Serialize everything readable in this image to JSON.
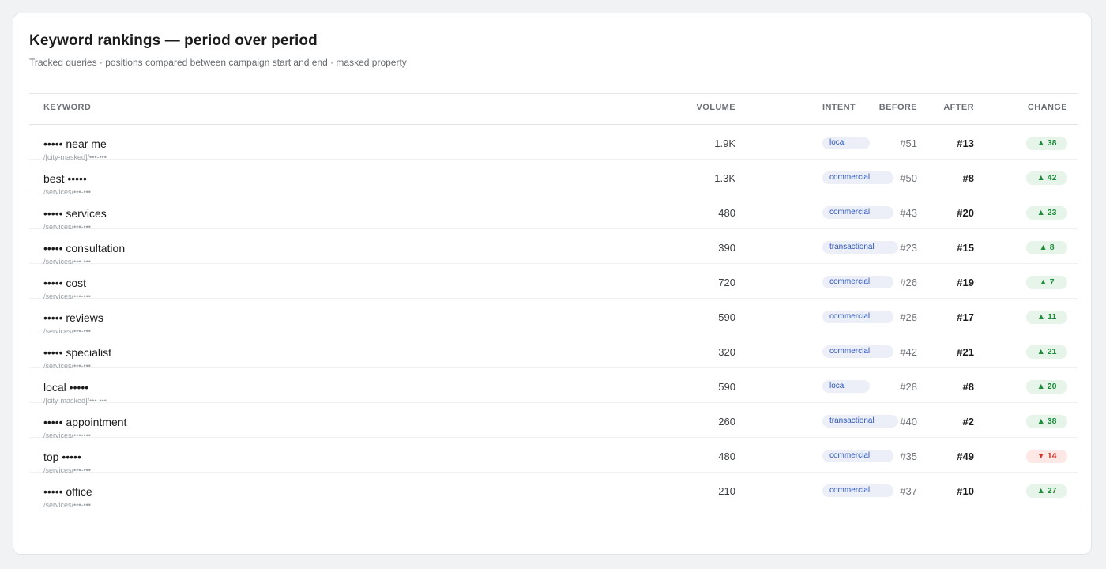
{
  "header": {
    "title": "Keyword rankings — period over period",
    "subtitle": "Tracked queries · positions compared between campaign start and end · masked property"
  },
  "columns": {
    "keyword": "KEYWORD",
    "volume": "VOLUME",
    "intent": "INTENT",
    "before": "BEFORE",
    "after": "AFTER",
    "change": "CHANGE"
  },
  "rows": [
    {
      "keyword": "••••• near me",
      "path": "/[city-masked]/•••-•••",
      "volume": "1.9K",
      "intent": "local",
      "before": "#51",
      "after": "#13",
      "change": "▲ 38",
      "direction": "up"
    },
    {
      "keyword": "best •••••",
      "path": "/services/•••-•••",
      "volume": "1.3K",
      "intent": "commercial",
      "before": "#50",
      "after": "#8",
      "change": "▲ 42",
      "direction": "up"
    },
    {
      "keyword": "••••• services",
      "path": "/services/•••-•••",
      "volume": "480",
      "intent": "commercial",
      "before": "#43",
      "after": "#20",
      "change": "▲ 23",
      "direction": "up"
    },
    {
      "keyword": "••••• consultation",
      "path": "/services/•••-•••",
      "volume": "390",
      "intent": "transactional",
      "before": "#23",
      "after": "#15",
      "change": "▲ 8",
      "direction": "up"
    },
    {
      "keyword": "••••• cost",
      "path": "/services/•••-•••",
      "volume": "720",
      "intent": "commercial",
      "before": "#26",
      "after": "#19",
      "change": "▲ 7",
      "direction": "up"
    },
    {
      "keyword": "••••• reviews",
      "path": "/services/•••-•••",
      "volume": "590",
      "intent": "commercial",
      "before": "#28",
      "after": "#17",
      "change": "▲ 11",
      "direction": "up"
    },
    {
      "keyword": "••••• specialist",
      "path": "/services/•••-•••",
      "volume": "320",
      "intent": "commercial",
      "before": "#42",
      "after": "#21",
      "change": "▲ 21",
      "direction": "up"
    },
    {
      "keyword": "local •••••",
      "path": "/[city-masked]/•••-•••",
      "volume": "590",
      "intent": "local",
      "before": "#28",
      "after": "#8",
      "change": "▲ 20",
      "direction": "up"
    },
    {
      "keyword": "••••• appointment",
      "path": "/services/•••-•••",
      "volume": "260",
      "intent": "transactional",
      "before": "#40",
      "after": "#2",
      "change": "▲ 38",
      "direction": "up"
    },
    {
      "keyword": "top •••••",
      "path": "/services/•••-•••",
      "volume": "480",
      "intent": "commercial",
      "before": "#35",
      "after": "#49",
      "change": "▼ 14",
      "direction": "down"
    },
    {
      "keyword": "••••• office",
      "path": "/services/•••-•••",
      "volume": "210",
      "intent": "commercial",
      "before": "#37",
      "after": "#10",
      "change": "▲ 27",
      "direction": "up"
    }
  ],
  "colors": {
    "up_text": "#1f8a3a",
    "up_bg": "#e6f4ea",
    "down_text": "#d0342c",
    "down_bg": "#fde8e6",
    "intent_text": "#2f55b8",
    "intent_bg": "#eceff8"
  }
}
